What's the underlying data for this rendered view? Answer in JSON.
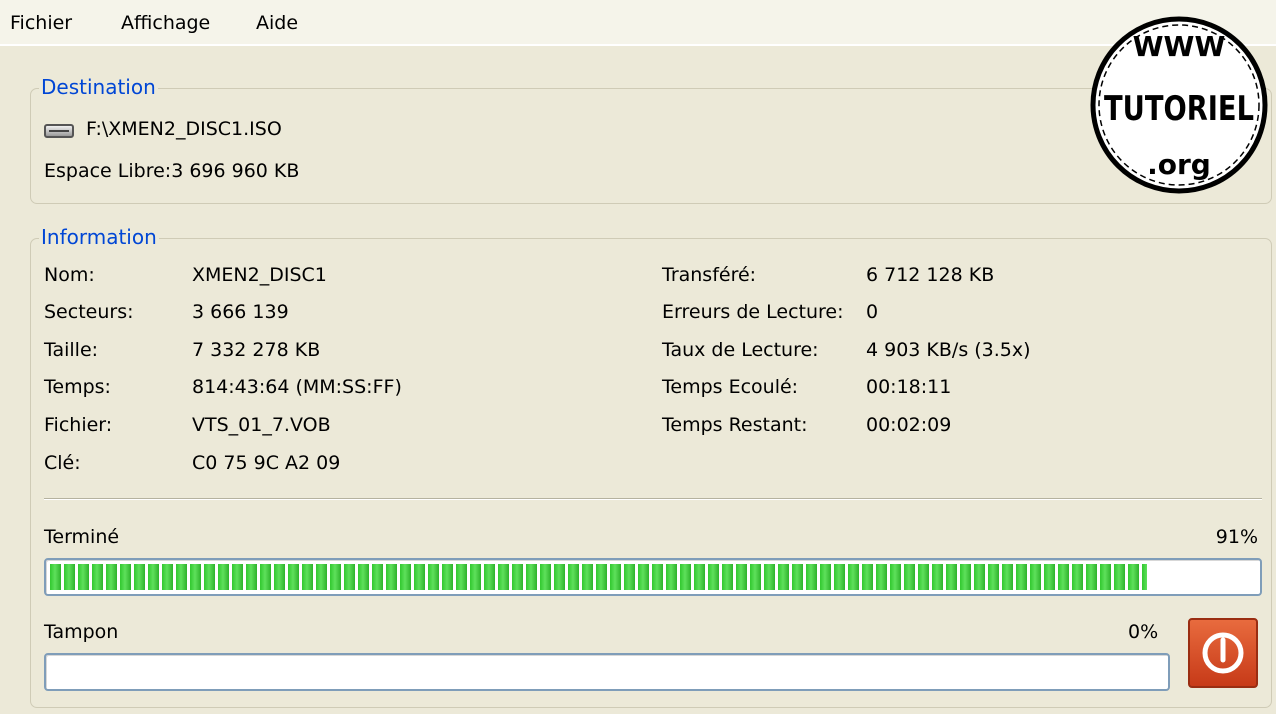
{
  "menu": {
    "items": [
      "Fichier",
      "Affichage",
      "Aide"
    ]
  },
  "destination": {
    "legend": "Destination",
    "path": "F:\\XMEN2_DISC1.ISO",
    "free_space": "Espace Libre:3 696 960 KB"
  },
  "information": {
    "legend": "Information",
    "left": [
      {
        "label": "Nom:",
        "value": "XMEN2_DISC1"
      },
      {
        "label": "Secteurs:",
        "value": "3 666 139"
      },
      {
        "label": "Taille:",
        "value": "7 332 278 KB"
      },
      {
        "label": "Temps:",
        "value": "814:43:64 (MM:SS:FF)"
      },
      {
        "label": "Fichier:",
        "value": "VTS_01_7.VOB"
      },
      {
        "label": "Clé:",
        "value": "C0 75 9C A2 09"
      }
    ],
    "right": [
      {
        "label": "Transféré:",
        "value": "6 712 128 KB"
      },
      {
        "label": "Erreurs de Lecture:",
        "value": "0"
      },
      {
        "label": "Taux de Lecture:",
        "value": "4 903 KB/s (3.5x)"
      },
      {
        "label": "Temps Ecoulé:",
        "value": "00:18:11"
      },
      {
        "label": "Temps Restant:",
        "value": "00:02:09"
      }
    ]
  },
  "progress": {
    "done_label": "Terminé",
    "done_percent_text": "91%",
    "done_fraction": 0.91,
    "buffer_label": "Tampon",
    "buffer_percent_text": "0%",
    "buffer_fraction": 0.0
  },
  "watermark": {
    "top": "WWW",
    "middle": "TUTORIEL",
    "bottom": ".org"
  },
  "icons": {
    "drive": "hard-drive-icon",
    "stop": "power-stop-icon"
  },
  "colors": {
    "legend": "#0046d5",
    "progress": "#31c82f",
    "stop_button": "#d8512a"
  }
}
